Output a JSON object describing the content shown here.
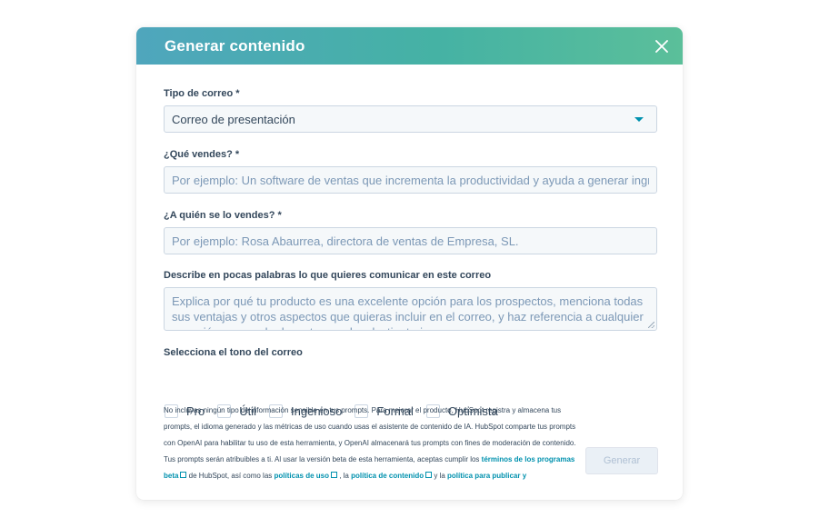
{
  "modal": {
    "title": "Generar contenido"
  },
  "form": {
    "email_type": {
      "label": "Tipo de correo *",
      "value": "Correo de presentación"
    },
    "what_sell": {
      "label": "¿Qué vendes? *",
      "placeholder": "Por ejemplo: Un software de ventas que incrementa la productividad y ayuda a generar ingre"
    },
    "who_sell": {
      "label": "¿A quién se lo vendes? *",
      "placeholder": "Por ejemplo: Rosa Abaurrea, directora de ventas de Empresa, SL."
    },
    "describe": {
      "label": "Describe en pocas palabras lo que quieres comunicar en este correo",
      "placeholder": "Explica por qué tu producto es una excelente opción para los prospectos, menciona todas sus ventajas y otros aspectos que quieras incluir en el correo, y haz referencia a cualquier conexión personal relevante para los destinatarios."
    },
    "tone": {
      "label": "Selecciona el tono del correo",
      "options": [
        "Pro",
        "Útil",
        "Ingenioso",
        "Formal",
        "Optimista"
      ]
    }
  },
  "disclaimer": {
    "text1": "No incluyas ningún tipo de información sensible en tus prompts. Para mejorar el producto, HubSpot registra y almacena tus prompts, el idioma generado y las métricas de uso cuando usas el asistente de contenido de IA. HubSpot comparte tus prompts con OpenAI para habilitar tu uso de esta herramienta, y OpenAI almacenará tus prompts con fines de moderación de contenido. Tus prompts serán atribuibles a ti. Al usar la versión beta de esta herramienta, aceptas cumplir los ",
    "link1": "términos de los programas beta",
    "text2": " de HubSpot, así como las ",
    "link2": "políticas de uso",
    "text3": " , la ",
    "link3": "política de contenido",
    "text4": "  y la ",
    "link4": "política para publicar y"
  },
  "actions": {
    "generate_label": "Generar"
  },
  "colors": {
    "header_gradient_start": "#4fa6bd",
    "header_gradient_end": "#5bbf9a",
    "link": "#0091ae",
    "text": "#33475b",
    "placeholder": "#7c98b6"
  }
}
